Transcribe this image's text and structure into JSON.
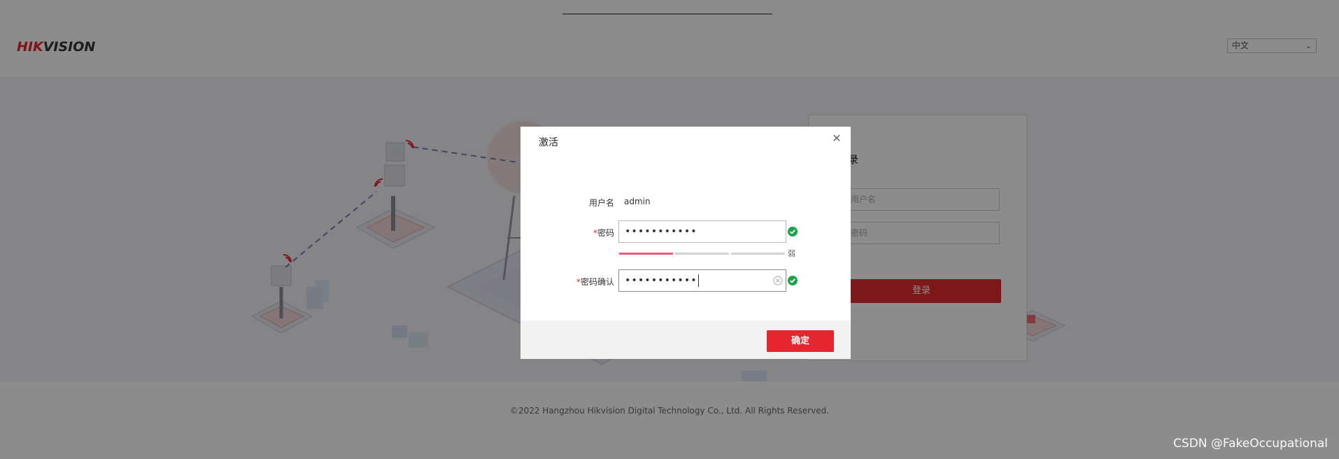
{
  "header": {
    "logo": {
      "red_part": "HIK",
      "dark_part": "VISION"
    },
    "language_select": {
      "value": "中文"
    }
  },
  "login_panel": {
    "title": "登录",
    "username_placeholder": "用户名",
    "password_placeholder": "密码",
    "login_button": "登录"
  },
  "footer": {
    "copyright": "©2022 Hangzhou Hikvision Digital Technology Co., Ltd. All Rights Reserved."
  },
  "dialog": {
    "title": "激活",
    "username_label": "用户名",
    "username_value": "admin",
    "password_label": "密码",
    "password_value": "•••••••••••",
    "password_confirm_label": "密码确认",
    "password_confirm_value": "•••••••••••",
    "required_mark": "*",
    "strength_label": "弱",
    "strength_level_of_3": 1,
    "confirm_button": "确定"
  },
  "colors": {
    "brand_red": "#e5262e",
    "valid_green": "#1aa34a",
    "strength_weak": "#f0577a"
  },
  "watermark": "CSDN @FakeOccupational"
}
